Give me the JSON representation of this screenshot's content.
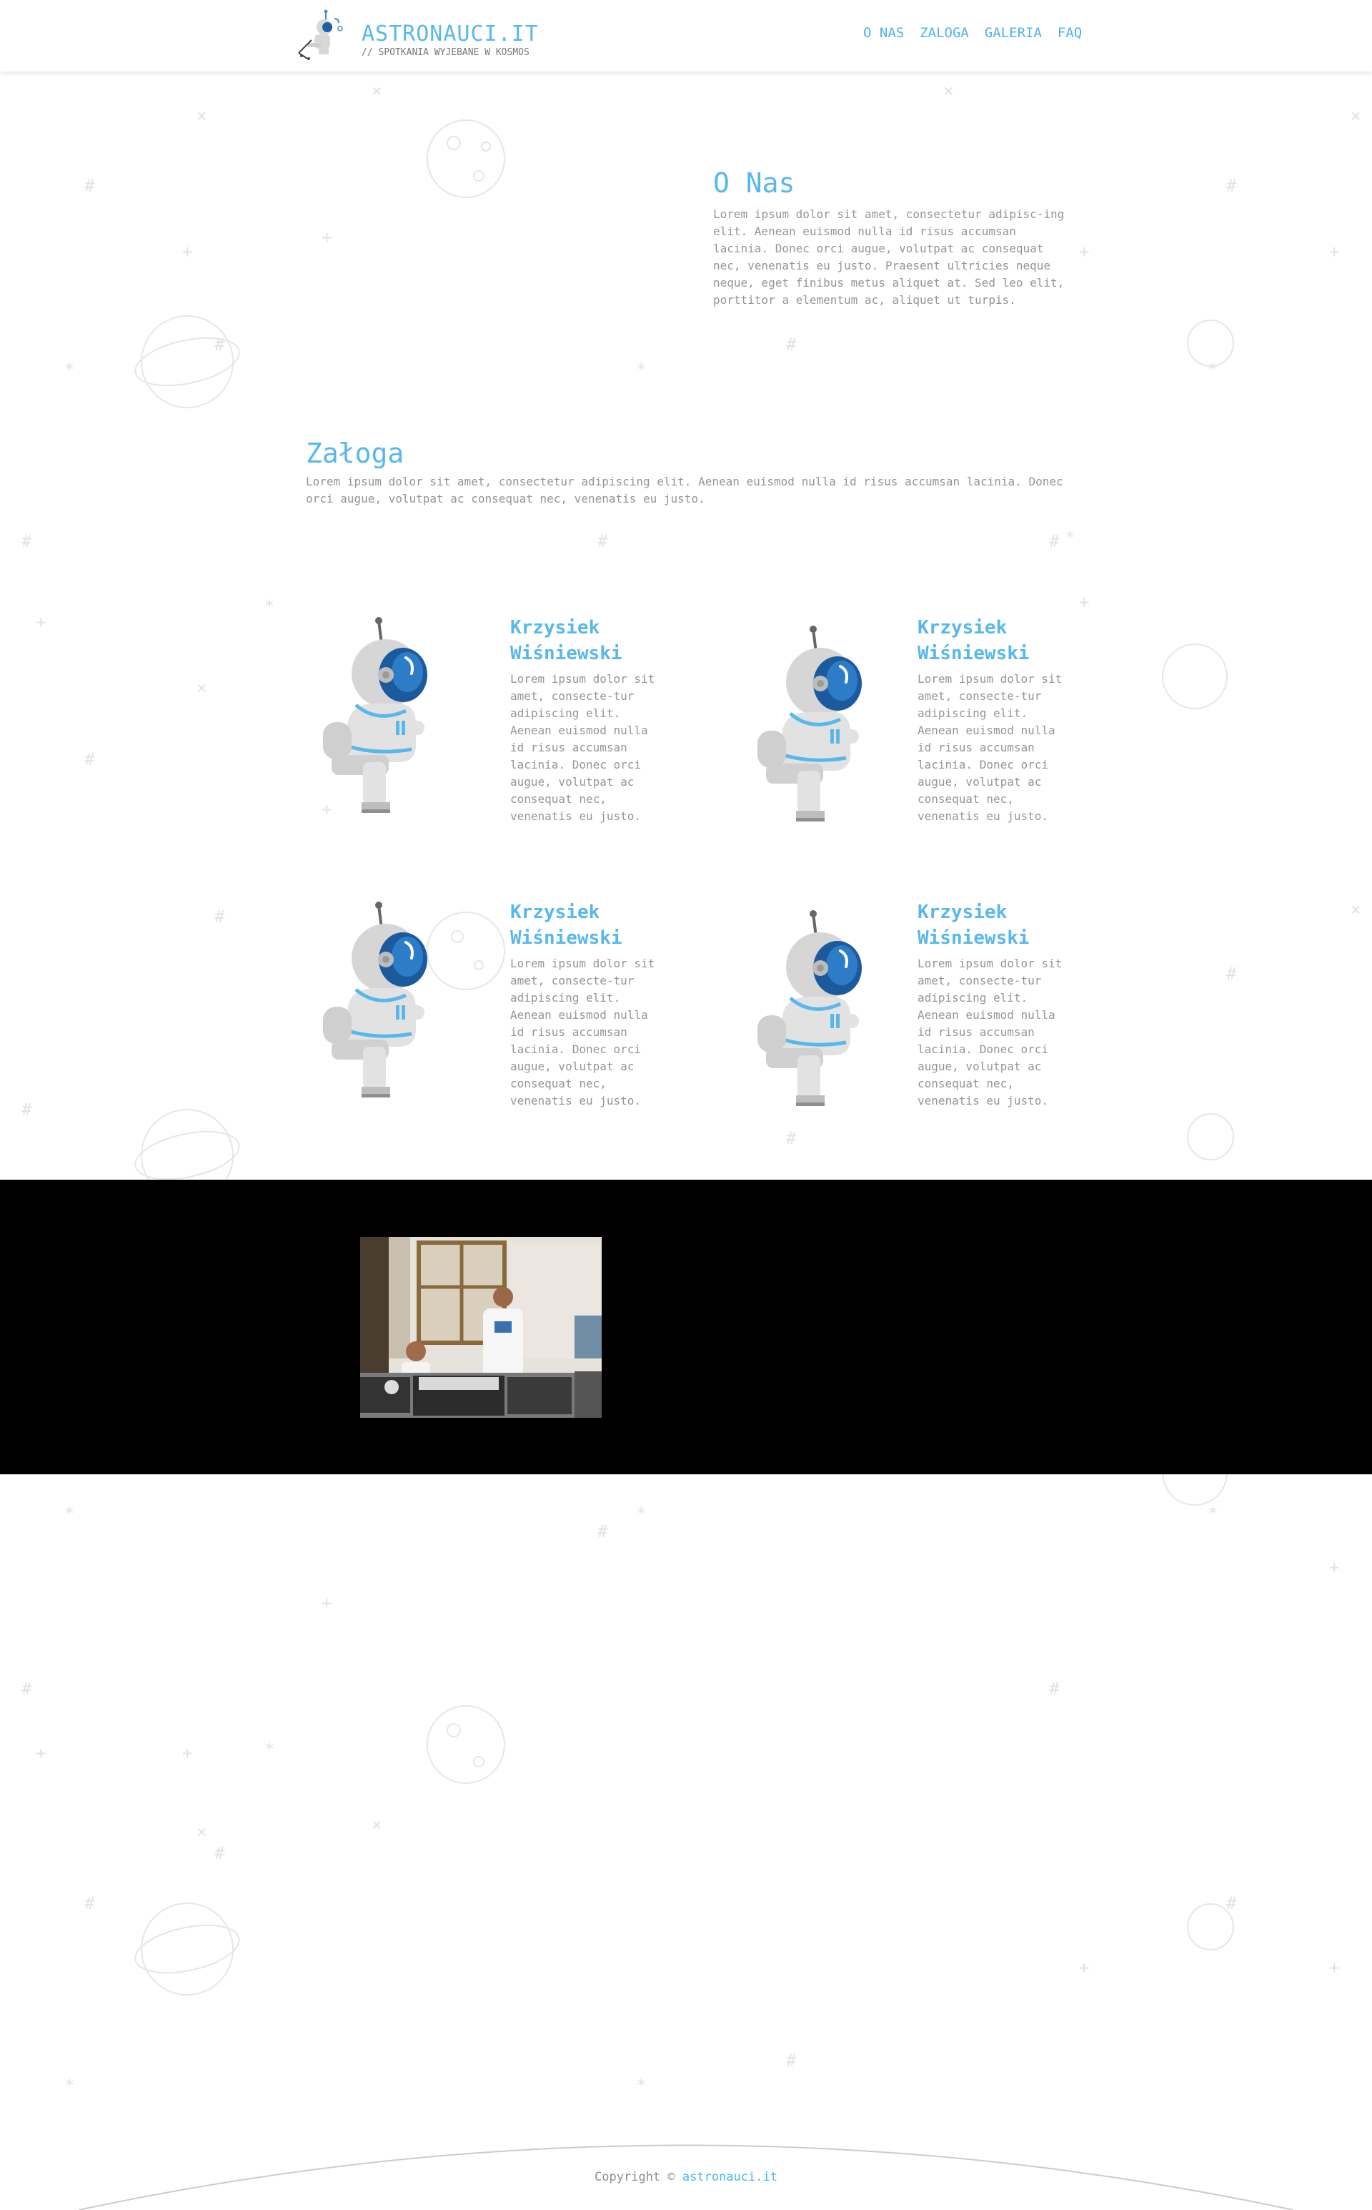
{
  "header": {
    "logo_title": "ASTRONAUCI.IT",
    "logo_subtitle": "// SPOTKANIA WYJEBANE W KOSMOS",
    "nav": [
      "O NAS",
      "ZALOGA",
      "GALERIA",
      "FAQ"
    ]
  },
  "about": {
    "title": "O Nas",
    "text": "Lorem ipsum dolor sit amet, consectetur adipisc-ing elit. Aenean euismod nulla id risus accumsan lacinia. Donec orci augue, volutpat ac consequat nec, venenatis eu justo. Praesent ultricies neque neque, eget finibus metus aliquet at. Sed leo elit, porttitor a elementum ac, aliquet ut turpis."
  },
  "crew": {
    "title": "Załoga",
    "text": "Lorem ipsum dolor sit amet, consectetur adipiscing elit. Aenean euismod nulla id risus accumsan lacinia. Donec orci augue, volutpat ac consequat nec, venenatis eu justo.",
    "members": [
      {
        "name": "Krzysiek Wiśniewski",
        "bio": "Lorem ipsum dolor sit amet, consecte-tur adipiscing elit. Aenean euismod nulla id risus accumsan lacinia. Donec orci augue, volutpat ac consequat nec, venenatis eu justo."
      },
      {
        "name": "Krzysiek Wiśniewski",
        "bio": "Lorem ipsum dolor sit amet, consecte-tur adipiscing elit. Aenean euismod nulla id risus accumsan lacinia. Donec orci augue, volutpat ac consequat nec, venenatis eu justo."
      },
      {
        "name": "Krzysiek Wiśniewski",
        "bio": "Lorem ipsum dolor sit amet, consecte-tur adipiscing elit. Aenean euismod nulla id risus accumsan lacinia. Donec orci augue, volutpat ac consequat nec, venenatis eu justo."
      },
      {
        "name": "Krzysiek Wiśniewski",
        "bio": "Lorem ipsum dolor sit amet, consecte-tur adipiscing elit. Aenean euismod nulla id risus accumsan lacinia. Donec orci augue, volutpat ac consequat nec, venenatis eu justo."
      }
    ]
  },
  "footer": {
    "copyright_prefix": "Copyright ©",
    "site": "astronauci.it"
  },
  "colors": {
    "accent": "#58b8ec",
    "text": "#959595",
    "gallery_bg": "#000000"
  },
  "icons": {
    "logo": "astronaut-logo-icon",
    "crew_avatar": "seated-astronaut-illustration"
  }
}
